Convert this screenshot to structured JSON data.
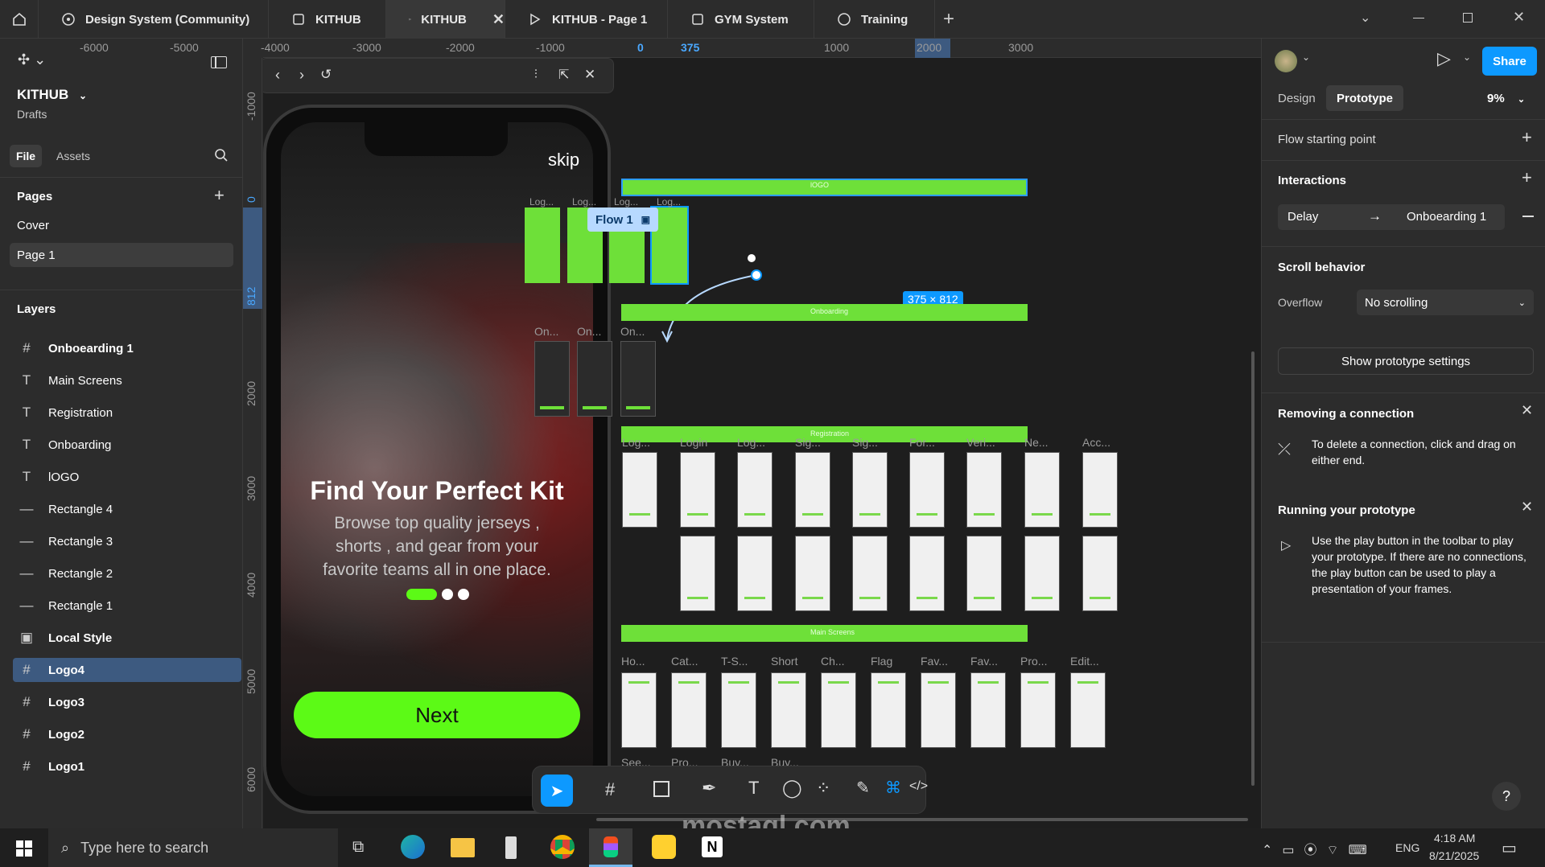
{
  "tabs": [
    {
      "label": "Design System (Community)"
    },
    {
      "label": "KITHUB"
    },
    {
      "label": "KITHUB"
    },
    {
      "label": "KITHUB - Page 1"
    },
    {
      "label": "GYM System"
    },
    {
      "label": "Training"
    }
  ],
  "file": {
    "name": "KITHUB",
    "location": "Drafts",
    "tab_file": "File",
    "tab_assets": "Assets"
  },
  "pages": {
    "heading": "Pages",
    "items": [
      "Cover",
      "Page 1"
    ]
  },
  "layers": {
    "heading": "Layers",
    "items": [
      {
        "label": "Onboearding 1",
        "icon": "frame-icon",
        "bold": true
      },
      {
        "label": "Main Screens",
        "icon": "text-icon"
      },
      {
        "label": "Registration",
        "icon": "text-icon"
      },
      {
        "label": "Onboarding",
        "icon": "text-icon"
      },
      {
        "label": "lOGO",
        "icon": "text-icon"
      },
      {
        "label": "Rectangle 4",
        "icon": "line-icon"
      },
      {
        "label": "Rectangle 3",
        "icon": "line-icon"
      },
      {
        "label": "Rectangle 2",
        "icon": "line-icon"
      },
      {
        "label": "Rectangle 1",
        "icon": "line-icon"
      },
      {
        "label": "Local Style",
        "icon": "component-icon",
        "bold": true
      },
      {
        "label": "Logo4",
        "icon": "frame-icon",
        "bold": true,
        "selected": true
      },
      {
        "label": "Logo3",
        "icon": "frame-icon",
        "bold": true
      },
      {
        "label": "Logo2",
        "icon": "frame-icon",
        "bold": true
      },
      {
        "label": "Logo1",
        "icon": "frame-icon",
        "bold": true
      }
    ]
  },
  "ruler_top": [
    "-6000",
    "-5000",
    "-4000",
    "-3000",
    "-2000",
    "-1000",
    "0",
    "375",
    "1000",
    "2000",
    "3000"
  ],
  "ruler_left": [
    "-1000",
    "0",
    "812",
    "2000",
    "3000",
    "4000",
    "5000",
    "6000"
  ],
  "phone": {
    "skip": "skip",
    "title": "Find Your Perfect Kit",
    "body": "Browse top quality jerseys , shorts , and gear from your favorite teams all in one place.",
    "button": "Next"
  },
  "canvas": {
    "flow_label": "Flow 1",
    "dimensions": "375 × 812",
    "band_logo": "lOGO",
    "band_onboarding": "Onboarding",
    "band_registration": "Registration",
    "band_main": "Main Screens",
    "logo_labels": [
      "Log...",
      "Log...",
      "Log...",
      "Log..."
    ],
    "onboarding_labels": [
      "On...",
      "On...",
      "On..."
    ],
    "registration_labels": [
      "Log...",
      "Login",
      "Log...",
      "Sig...",
      "Sig...",
      "For...",
      "Veri...",
      "Ne...",
      "Acc..."
    ],
    "main_labels": [
      "Ho...",
      "Cat...",
      "T-S...",
      "Short",
      "Ch...",
      "Flag",
      "Fav...",
      "Fav...",
      "Pro...",
      "Edit..."
    ],
    "bottom_labels": [
      "See...",
      "Pro...",
      "Buy...",
      "Buy..."
    ],
    "watermark": "mostaql.com"
  },
  "right": {
    "tab_design": "Design",
    "tab_prototype": "Prototype",
    "zoom": "9%",
    "share": "Share",
    "flow_start": "Flow starting point",
    "interactions": "Interactions",
    "trigger": "Delay",
    "destination": "Onboearding 1",
    "scroll_behavior": "Scroll behavior",
    "overflow_label": "Overflow",
    "overflow_value": "No scrolling",
    "show_settings": "Show prototype settings",
    "removing_title": "Removing a connection",
    "removing_text": "To delete a connection, click and drag on either end.",
    "running_title": "Running your prototype",
    "running_text": "Use the play button in the toolbar to play your prototype. If there are no connections, the play button can be used to play a presentation of your frames.",
    "help": "?"
  },
  "taskbar": {
    "search_placeholder": "Type here to search",
    "lang": "ENG",
    "time": "4:18 AM",
    "date": "8/21/2025"
  },
  "colors": {
    "accent": "#0d99ff",
    "green": "#6ee039",
    "phone_button": "#5cfa16"
  }
}
